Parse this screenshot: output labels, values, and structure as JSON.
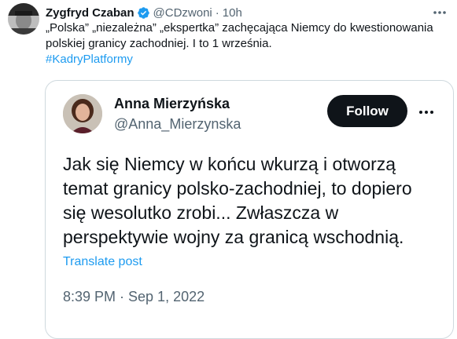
{
  "tweet": {
    "author_name": "Zygfryd Czaban",
    "author_handle": "@CDzwoni",
    "separator": "·",
    "time_ago": "10h",
    "text_lines": [
      "„Polska” „niezależna” „ekspertka” zachęcająca Niemcy do kwestionowania",
      "polskiej granicy zachodniej. I to 1 września."
    ],
    "hashtag": "#KadryPlatformy",
    "verified_color": "#1d9bf0"
  },
  "quoted_tweet": {
    "author_name": "Anna Mierzyńska",
    "author_handle": "@Anna_Mierzynska",
    "follow_label": "Follow",
    "text_lines": [
      "Jak się Niemcy w końcu wkurzą i otworzą",
      "temat granicy polsko-zachodniej, to dopiero",
      "się wesolutko zrobi... Zwłaszcza w",
      "perspektywie wojny za granicą wschodnią."
    ],
    "translate_label": "Translate post",
    "timestamp": "8:39 PM · Sep 1, 2022"
  },
  "icons": {
    "verified": "verified-badge-icon",
    "more": "more-dots-icon"
  }
}
